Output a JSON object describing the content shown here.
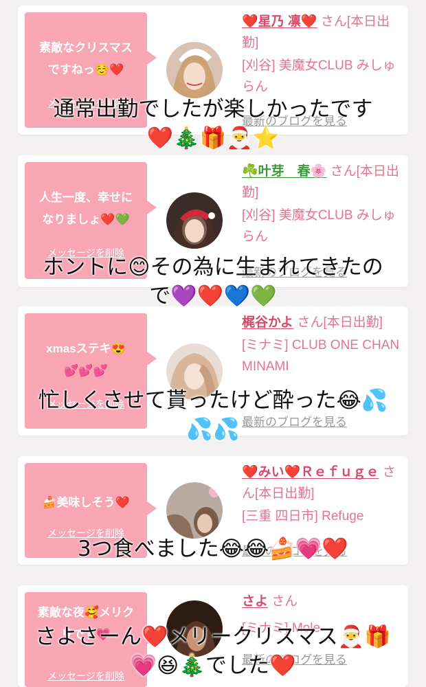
{
  "messages": [
    {
      "bubble_lines": [
        "素敵なクリスマス",
        "ですねっ☺️❤️"
      ],
      "delete_label": "メッセージを削除",
      "name": "❤️星乃 凛❤️",
      "suffix": " さん[本日出勤]",
      "shop": "[刈谷] 美魔女CLUB みしゅらん",
      "blog_label": "最新のブログを見る",
      "caption_lines": [
        "通常出勤でしたが楽しかったです",
        "❤️🎄🎁🎅⭐"
      ]
    },
    {
      "bubble_lines": [
        "人生一度、幸せに",
        "なりましょ❤️💚"
      ],
      "delete_label": "メッセージを削除",
      "name": "☘️叶芽　春🌸",
      "suffix": " さん[本日出勤]",
      "shop": "[刈谷] 美魔女CLUB みしゅらん",
      "blog_label": "最新のブログを見る",
      "caption_lines": [
        "ホントに😊その為に生まれてきたの",
        "で💜❤️💙💚"
      ]
    },
    {
      "bubble_lines": [
        "xmasステキ😍",
        "💕💕💕"
      ],
      "delete_label": "メッセージを削除",
      "name": "梶谷かよ",
      "suffix": " さん[本日出勤]",
      "shop": "[ミナミ] CLUB ONE CHAN MINAMI",
      "blog_label": "最新のブログを見る",
      "caption_lines": [
        "忙しくさせて貰ったけど酔った😂💦",
        "💦💦"
      ]
    },
    {
      "bubble_lines": [
        "🍰美味しそう❤️"
      ],
      "delete_label": "メッセージを削除",
      "name": "❤️みい❤️Ｒｅｆｕｇｅ",
      "suffix": " さん[本日出勤]",
      "shop": "[三重 四日市] Refuge",
      "blog_label": "最新のブログを見る",
      "caption_lines": [
        "3つ食べました😂😂🍰💗❤️"
      ]
    },
    {
      "bubble_lines": [
        "素敵な夜🥰メリク",
        "リです💗"
      ],
      "delete_label": "メッセージを削除",
      "name": "さよ",
      "suffix": " さん",
      "shop": "[ミナミ] Mole",
      "blog_label": "最新のブログを見る",
      "caption_lines": [
        "さよさーん❤️メリークリスマス🎅🎁",
        "💗😆🎄でした❤️"
      ]
    }
  ],
  "colors": {
    "bubble": "#f8a5b4",
    "name": "#d64a6a",
    "info": "#e5738d",
    "link": "#999999",
    "background": "#f3f0f1"
  }
}
